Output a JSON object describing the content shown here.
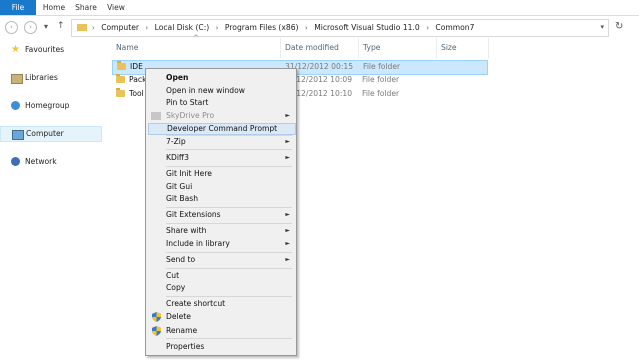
{
  "ribbon": {
    "tabs": [
      "File",
      "Home",
      "Share",
      "View"
    ]
  },
  "address": {
    "crumbs": [
      "Computer",
      "Local Disk (C:)",
      "Program Files (x86)",
      "Microsoft Visual Studio 11.0",
      "Common7"
    ],
    "separator": "›"
  },
  "icons": {
    "back": "‹",
    "forward": "›",
    "recent": "▾",
    "up": "↑",
    "dropdown": "▾",
    "refresh": "↻"
  },
  "sidebar": {
    "items": [
      {
        "label": "Favourites",
        "icon": "star-icon"
      },
      {
        "label": "Libraries",
        "icon": "libraries-icon"
      },
      {
        "label": "Homegroup",
        "icon": "homegroup-icon"
      },
      {
        "label": "Computer",
        "icon": "computer-icon",
        "selected": true
      },
      {
        "label": "Network",
        "icon": "network-icon"
      }
    ]
  },
  "columns": {
    "name": "Name",
    "date": "Date modified",
    "type": "Type",
    "size": "Size",
    "sort_indicator": "^"
  },
  "files": [
    {
      "name": "IDE",
      "date": "31/12/2012 00:15",
      "type": "File folder"
    },
    {
      "name": "Pack",
      "date": "31/12/2012 10:09",
      "type": "File folder"
    },
    {
      "name": "Tool",
      "date": "31/12/2012 10:10",
      "type": "File folder"
    }
  ],
  "context_menu": {
    "items": [
      {
        "label": "Open"
      },
      {
        "label": "Open in new window"
      },
      {
        "label": "Pin to Start"
      },
      {
        "label": "SkyDrive Pro"
      },
      {
        "label": "Developer Command Prompt"
      },
      {
        "label": "7-Zip"
      },
      {
        "label": "KDiff3"
      },
      {
        "label": "Git Init Here"
      },
      {
        "label": "Git Gui"
      },
      {
        "label": "Git Bash"
      },
      {
        "label": "Git Extensions"
      },
      {
        "label": "Share with"
      },
      {
        "label": "Include in library"
      },
      {
        "label": "Send to"
      },
      {
        "label": "Cut"
      },
      {
        "label": "Copy"
      },
      {
        "label": "Create shortcut"
      },
      {
        "label": "Delete"
      },
      {
        "label": "Rename"
      },
      {
        "label": "Properties"
      }
    ],
    "submenu_arrow": "►"
  },
  "colors": {
    "accent": "#1979ca",
    "selection": "#cce8ff",
    "menu_highlight": "#dbe9f7",
    "folder": "#e9c35a"
  }
}
